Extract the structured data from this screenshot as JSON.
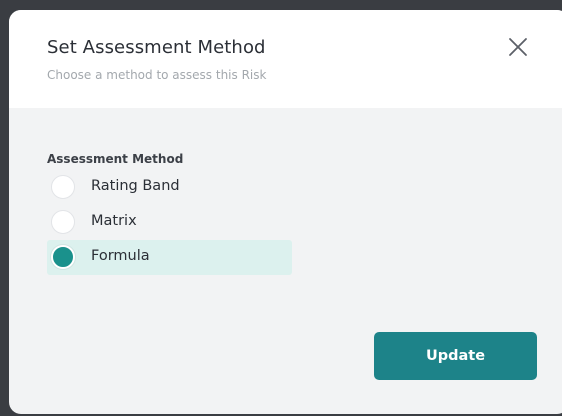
{
  "modal": {
    "title": "Set Assessment Method",
    "subtitle": "Choose a method to assess this Risk",
    "close_icon": "close-icon"
  },
  "form": {
    "label": "Assessment Method",
    "options": [
      {
        "label": "Rating Band",
        "selected": false
      },
      {
        "label": "Matrix",
        "selected": false
      },
      {
        "label": "Formula",
        "selected": true
      }
    ]
  },
  "actions": {
    "update_label": "Update"
  },
  "colors": {
    "accent": "#1a918c",
    "button": "#1d8389",
    "selected_bg": "#dcf1ee"
  }
}
